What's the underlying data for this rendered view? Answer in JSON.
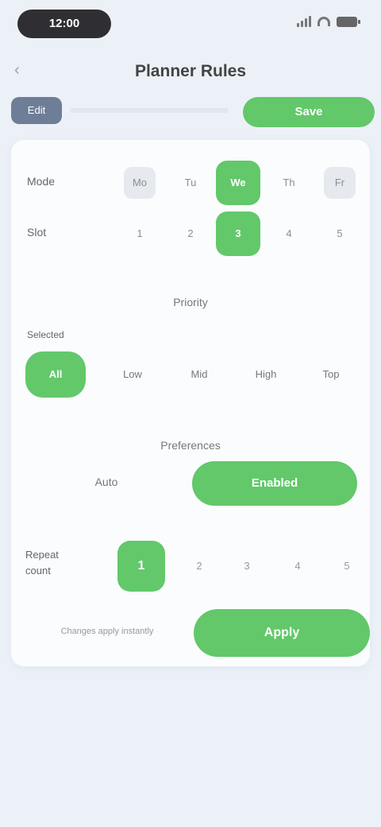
{
  "status_bar": {
    "time": "12:00"
  },
  "nav": {
    "back_label": "‹",
    "title": "Planner Rules"
  },
  "toolbar": {
    "segment_label": "Edit",
    "primary_label": "Save"
  },
  "grid": {
    "rows": [
      {
        "label": "Mode",
        "cells": [
          "Mo",
          "Tu",
          "We",
          "Th",
          "Fr"
        ],
        "active_index": 2
      },
      {
        "label": "Slot",
        "cells": [
          "1",
          "2",
          "3",
          "4",
          "5"
        ],
        "active_index": 2
      }
    ]
  },
  "section_priority": "Priority",
  "chips": {
    "title": "Selected",
    "items": [
      "All",
      "Low",
      "Mid",
      "High",
      "Top"
    ],
    "active_index": 0
  },
  "section_preferences": "Preferences",
  "option": {
    "label": "Auto",
    "button_label": "Enabled"
  },
  "steps": {
    "label_line1": "Repeat",
    "label_line2": "count",
    "active_value": "1",
    "items": [
      "2",
      "3",
      "4",
      "5"
    ]
  },
  "cta": {
    "hint": "Changes apply instantly",
    "button_label": "Apply"
  },
  "colors": {
    "accent": "#62c86a",
    "segment": "#6e7e96",
    "background": "#ecf1f8"
  }
}
